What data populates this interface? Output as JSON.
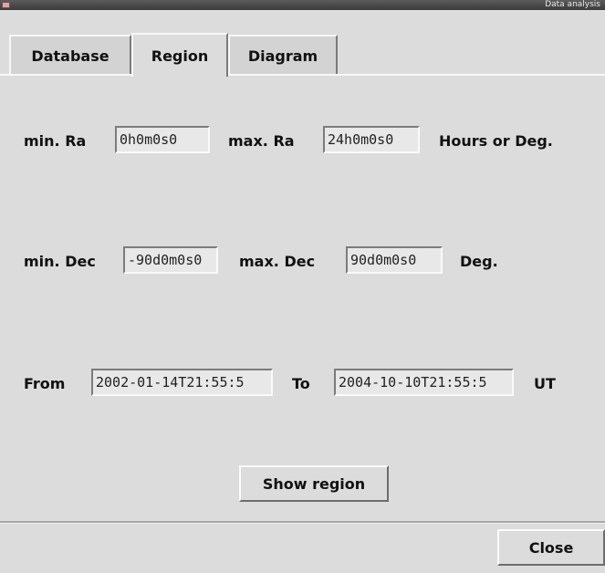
{
  "window": {
    "title": "Data analysis"
  },
  "tabs": [
    {
      "label": "Database",
      "active": false
    },
    {
      "label": "Region",
      "active": true
    },
    {
      "label": "Diagram",
      "active": false
    }
  ],
  "ra": {
    "min_label": "min. Ra",
    "min_value": "0h0m0s0",
    "max_label": "max. Ra",
    "max_value": "24h0m0s0",
    "unit": "Hours or Deg."
  },
  "dec": {
    "min_label": "min. Dec",
    "min_value": "-90d0m0s0",
    "max_label": "max. Dec",
    "max_value": "90d0m0s0",
    "unit": "Deg."
  },
  "time": {
    "from_label": "From",
    "from_value": "2002-01-14T21:55:5",
    "to_label": "To",
    "to_value": "2004-10-10T21:55:5",
    "unit": "UT"
  },
  "buttons": {
    "show_region": "Show region",
    "close": "Close"
  }
}
